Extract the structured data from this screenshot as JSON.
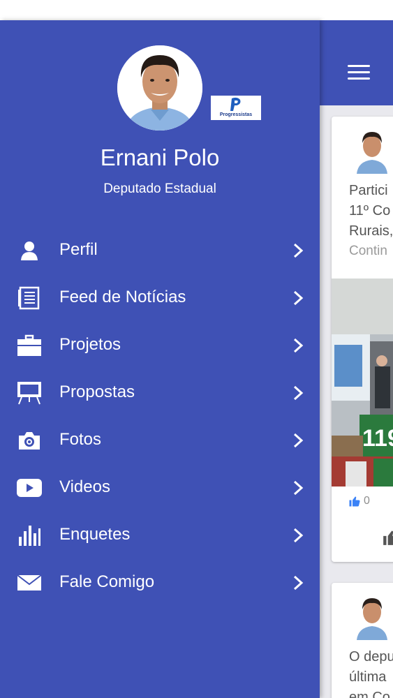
{
  "profile": {
    "name": "Ernani Polo",
    "role": "Deputado Estadual",
    "party_logo_text": "Progressistas"
  },
  "menu": {
    "items": [
      {
        "label": "Perfil",
        "icon": "person-icon"
      },
      {
        "label": "Feed de Notícias",
        "icon": "news-feed-icon"
      },
      {
        "label": "Projetos",
        "icon": "briefcase-icon"
      },
      {
        "label": "Propostas",
        "icon": "presentation-board-icon"
      },
      {
        "label": "Fotos",
        "icon": "camera-icon"
      },
      {
        "label": "Videos",
        "icon": "play-video-icon"
      },
      {
        "label": "Enquetes",
        "icon": "bar-chart-icon"
      },
      {
        "label": "Fale Comigo",
        "icon": "envelope-icon"
      }
    ]
  },
  "feed": {
    "post1": {
      "snippet": "Partici\n11º Co\nRurais,",
      "continue_label": "Contin",
      "likes": "0"
    },
    "post2": {
      "snippet": "O depu\núltima\nem Co"
    }
  },
  "colors": {
    "primary": "#3f51b5",
    "background": "#e9e9ee",
    "like_blue": "#3b82f6"
  }
}
